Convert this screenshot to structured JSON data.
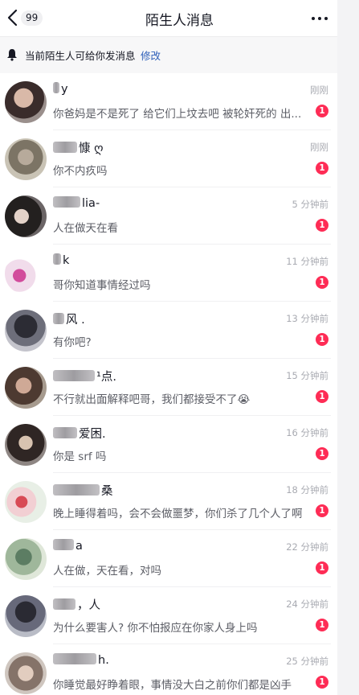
{
  "header": {
    "back_icon": "chevron-left-icon",
    "unread_count": "99",
    "title": "陌生人消息",
    "more_icon": "ellipsis-icon"
  },
  "notice": {
    "icon": "bell-icon",
    "text": "当前陌生人可给你发消息",
    "link": "修改"
  },
  "colors": {
    "accent_red": "#fe2c55",
    "link_blue": "#2b5db8"
  },
  "messages": [
    {
      "name_visible": "y",
      "time": "刚刚",
      "text": "你爸妈是不是死了 给它们上坟去吧 被轮奸死的 出...",
      "unread": "1"
    },
    {
      "name_visible": "慷 ღ",
      "time": "刚刚",
      "text": "你不内疚吗",
      "unread": "1"
    },
    {
      "name_visible": "lia-",
      "time": "5 分钟前",
      "text": "人在做天在看",
      "unread": "1"
    },
    {
      "name_visible": "k",
      "time": "11 分钟前",
      "text": "哥你知道事情经过吗",
      "unread": "1"
    },
    {
      "name_visible": "风 .",
      "time": "13 分钟前",
      "text": "有你吧?",
      "unread": "1"
    },
    {
      "name_visible": "¹点.",
      "time": "15 分钟前",
      "text": "不行就出面解释吧哥，我们都接受不了😭",
      "unread": "1"
    },
    {
      "name_visible": "爱困.",
      "time": "16 分钟前",
      "text": "你是 srf 吗",
      "unread": "1"
    },
    {
      "name_visible": "桑",
      "time": "18 分钟前",
      "text": "晚上睡得着吗，会不会做噩梦，你们杀了几个人了啊",
      "unread": "1"
    },
    {
      "name_visible": "a",
      "time": "22 分钟前",
      "text": "人在做，天在看，对吗",
      "unread": "1"
    },
    {
      "name_visible": "，人",
      "time": "24 分钟前",
      "text": "为什么要害人? 你不怕报应在你家人身上吗",
      "unread": "1"
    },
    {
      "name_visible": "h.",
      "time": "25 分钟前",
      "text": "你睡觉最好睁着眼，事情没大白之前你们都是凶手",
      "unread": "1"
    }
  ]
}
